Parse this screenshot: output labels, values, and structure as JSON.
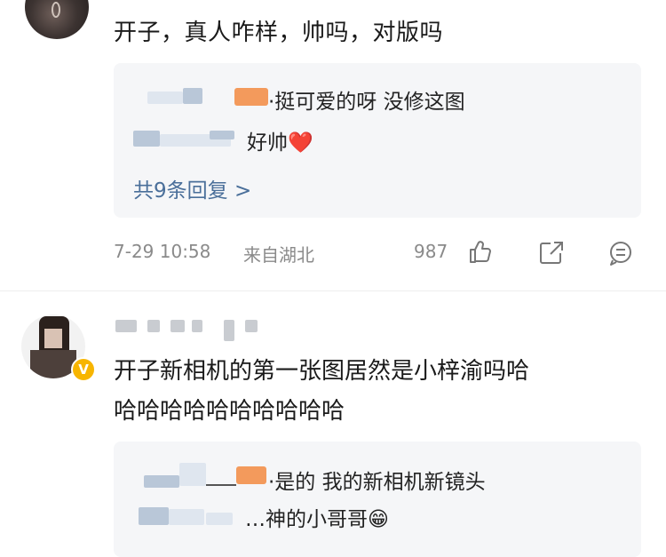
{
  "comment1": {
    "text": "开子，真人咋样，帅吗，对版吗",
    "replies": [
      {
        "text": "·挺可爱的呀 没修这图"
      },
      {
        "text": "好帅❤️"
      }
    ],
    "more_replies": "共9条回复 >",
    "meta": {
      "time": "7-29 10:58",
      "location": "来自湖北",
      "like_count": "987"
    }
  },
  "comment2": {
    "text_line1": "开子新相机的第一张图居然是小梓渝吗哈",
    "text_line2": "哈哈哈哈哈哈哈哈哈哈",
    "verified_badge": "V",
    "replies": [
      {
        "text": "·是的 我的新相机新镜头"
      },
      {
        "text": "…神的小哥哥😁"
      }
    ]
  },
  "icons": {
    "like": "thumbs-up-icon",
    "share": "share-icon",
    "comment": "comment-icon"
  },
  "colors": {
    "link": "#4a6f9a",
    "reply_bg": "#f5f6f8",
    "badge": "#f7b500"
  }
}
